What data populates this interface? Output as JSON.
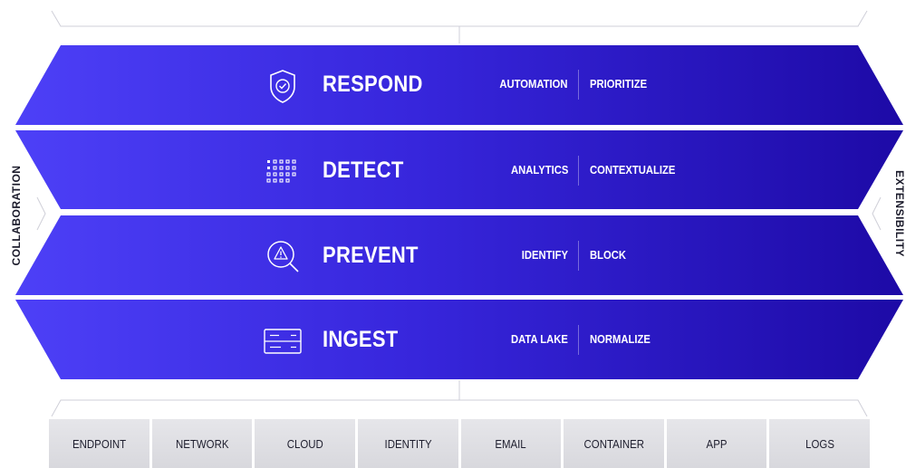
{
  "side_labels": {
    "left": "COLLABORATION",
    "right": "EXTENSIBILITY"
  },
  "layers": [
    {
      "title": "RESPOND",
      "icon": "shield-check-icon",
      "tags": [
        "AUTOMATION",
        "PRIORITIZE"
      ]
    },
    {
      "title": "DETECT",
      "icon": "dot-grid-icon",
      "tags": [
        "ANALYTICS",
        "CONTEXTUALIZE"
      ]
    },
    {
      "title": "PREVENT",
      "icon": "alert-search-icon",
      "tags": [
        "IDENTIFY",
        "BLOCK"
      ]
    },
    {
      "title": "INGEST",
      "icon": "server-icon",
      "tags": [
        "DATA LAKE",
        "NORMALIZE"
      ]
    }
  ],
  "sources": [
    "ENDPOINT",
    "NETWORK",
    "CLOUD",
    "IDENTITY",
    "EMAIL",
    "CONTAINER",
    "APP",
    "LOGS"
  ],
  "colors": {
    "band_light": "#4b3ef5",
    "band_mid": "#3223d8",
    "band_dark": "#1c0aa8",
    "source_light": "#e6e6ea",
    "source_dark": "#d8d8dd"
  }
}
